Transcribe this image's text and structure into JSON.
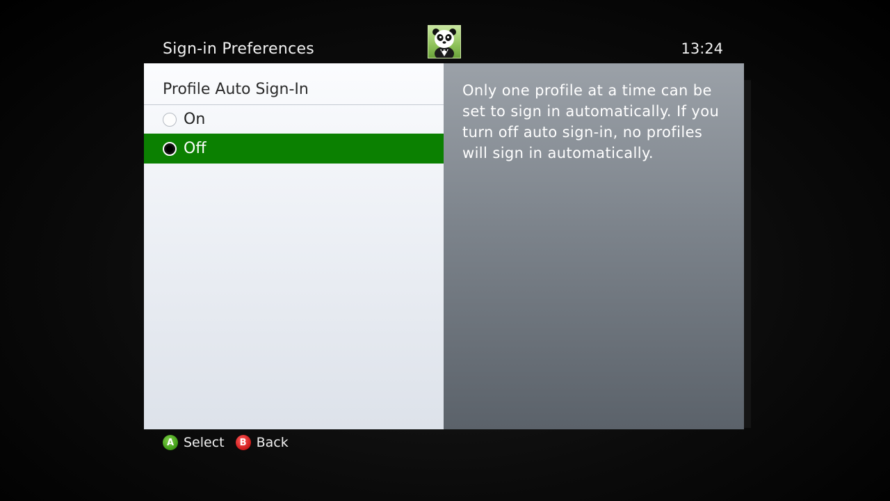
{
  "header": {
    "title": "Sign-in Preferences",
    "time": "13:24"
  },
  "avatar": {
    "icon": "panda-avatar-icon",
    "bg_color": "#8fc25a"
  },
  "left_pane": {
    "section_title": "Profile Auto Sign-In",
    "options": [
      {
        "label": "On",
        "selected": false
      },
      {
        "label": "Off",
        "selected": true
      }
    ],
    "highlight_color": "#0b8001"
  },
  "right_pane": {
    "description": "Only one profile at a time can be set to sign in automatically. If you turn off auto sign-in, no profiles will sign in automatically."
  },
  "footer": {
    "a_button": {
      "glyph": "A",
      "label": "Select",
      "color": "#3e9a15"
    },
    "b_button": {
      "glyph": "B",
      "label": "Back",
      "color": "#cc1a1a"
    }
  }
}
